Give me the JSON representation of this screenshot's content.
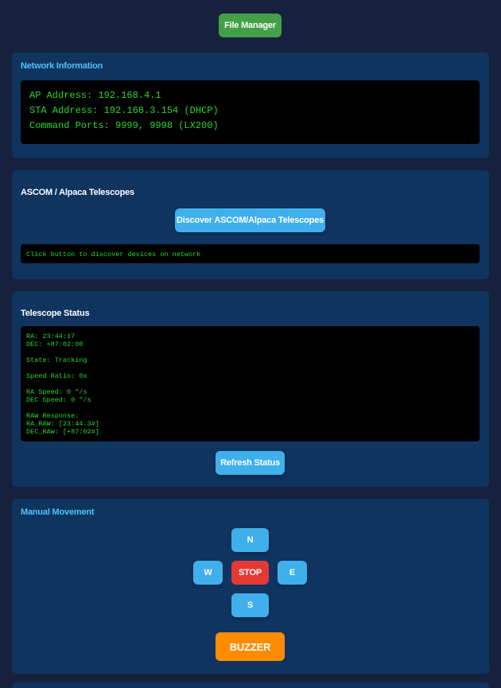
{
  "header": {
    "file_manager_label": "File Manager"
  },
  "network": {
    "title": "Network Information",
    "lines": [
      "AP Address: 192.168.4.1",
      "STA Address: 192.168.3.154 (DHCP)",
      "Command Ports: 9999, 9998 (LX200)"
    ]
  },
  "ascom": {
    "title": "ASCOM / Alpaca Telescopes",
    "discover_label": "Discover ASCOM/Alpaca Telescopes",
    "output": "Click button to discover devices on network"
  },
  "status": {
    "title": "Telescope Status",
    "ra": "RA: 23:44:17",
    "dec": "DEC: +87:02:00",
    "state": "State: Tracking",
    "speed_ratio": "Speed Ratio: 0x",
    "ra_speed": "RA Speed: 0 \"/s",
    "dec_speed": "DEC Speed: 0 \"/s",
    "raw_response": "RAW Response:",
    "ra_raw": "RA_RAW: [23:44.3#]",
    "dec_raw": "DEC_RAW: [+87:02#]",
    "refresh_label": "Refresh Status"
  },
  "movement": {
    "title": "Manual Movement",
    "north": "N",
    "west": "W",
    "stop": "STOP",
    "east": "E",
    "south": "S",
    "buzzer": "BUZZER"
  },
  "colors": {
    "background": "#16213e",
    "card": "#0f3460",
    "accent": "#4fc3f7",
    "terminal_text": "#27d827",
    "green_button": "#43a047",
    "blue_button": "#3fb0ec",
    "red_button": "#e53935",
    "orange_button": "#ff8c00"
  }
}
